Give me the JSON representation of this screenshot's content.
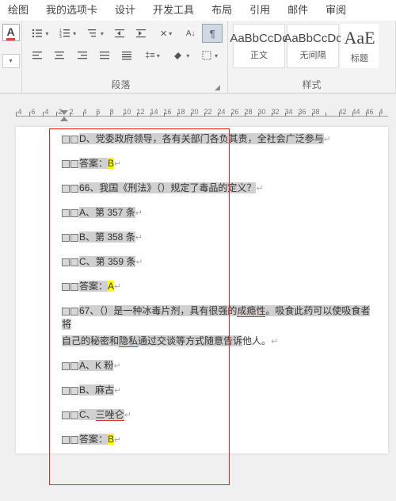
{
  "tabs": [
    "绘图",
    "我的选项卡",
    "设计",
    "开发工具",
    "布局",
    "引用",
    "邮件",
    "审阅"
  ],
  "ribbon": {
    "font_letter": "A",
    "paragraph_label": "段落",
    "styles_label": "样式",
    "styles": [
      {
        "sample": "AaBbCcDc",
        "name": "正文"
      },
      {
        "sample": "AaBbCcDc",
        "name": "无间隔"
      },
      {
        "sample": "AaE",
        "name": "标题"
      }
    ]
  },
  "ruler": {
    "labels": [
      -4,
      -6,
      -4,
      -2,
      2,
      4,
      6,
      8,
      10,
      12,
      14,
      16,
      18,
      20,
      22,
      24,
      26,
      28,
      30,
      32,
      34,
      36,
      38,
      "",
      42,
      44,
      46,
      4
    ]
  },
  "doc": {
    "l1": "D、党委政府领导，各有关部门各负其责，全社会广泛参与",
    "l2a": "答案：",
    "l2b": "B",
    "l3": "66、我国《刑法》（）规定了毒品的定义？",
    "l4": "A、第 357 条",
    "l5": "B、第 358 条",
    "l6": "C、第 359 条",
    "l7a": "答案：",
    "l7b": "A",
    "l8a": "67、（）是一种冰毒片剂，具有很强的",
    "l8b": "成瘾性",
    "l8c": "。吸食此药可以使吸食者将",
    "l9a": "自己的秘密和",
    "l9b": "隐私",
    "l9c": "通过交谈等方式随意告诉",
    "l9d": "他人。",
    "l10": "A、K 粉",
    "l11": "B、麻古",
    "l12a": "C、",
    "l12b": "三唑仑",
    "l13a": "答案：",
    "l13b": "B"
  }
}
